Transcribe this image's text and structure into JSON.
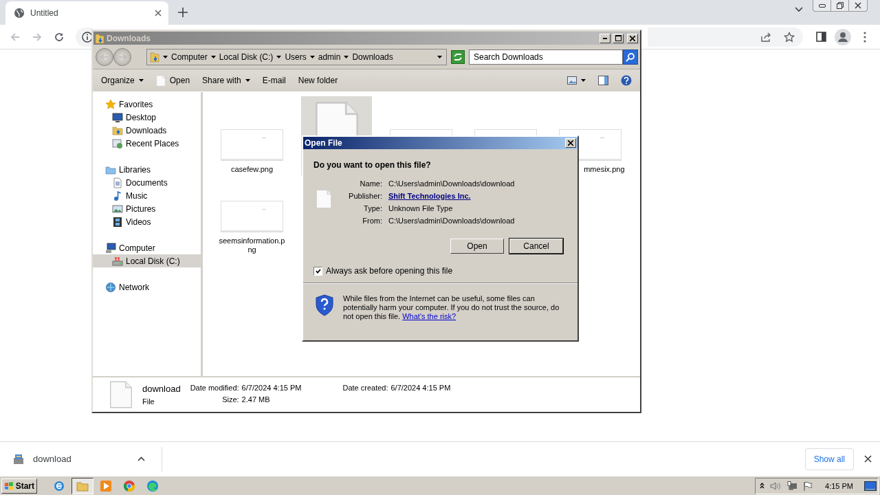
{
  "browser": {
    "tab_title": "Untitled",
    "nav_buttons": [
      {
        "kind": "back",
        "disabled": true
      },
      {
        "kind": "forward",
        "disabled": true
      },
      {
        "kind": "reload",
        "disabled": false
      }
    ]
  },
  "explorer": {
    "title": "Downloads",
    "breadcrumb": [
      "Computer",
      "Local Disk (C:)",
      "Users",
      "admin",
      "Downloads"
    ],
    "search": {
      "placeholder": "Search Downloads"
    },
    "commands": [
      {
        "label": "Organize",
        "kind": "menu"
      },
      {
        "label": "Open",
        "kind": "file"
      },
      {
        "label": "Share with",
        "kind": "menu"
      },
      {
        "label": "E-mail",
        "kind": "plain"
      },
      {
        "label": "New folder",
        "kind": "plain"
      }
    ],
    "nav_tree": [
      {
        "label": "Favorites",
        "kind": "star",
        "selected": false,
        "children": [
          {
            "label": "Desktop",
            "kind": "desktop",
            "selected": false
          },
          {
            "label": "Downloads",
            "kind": "download-folder",
            "selected": false
          },
          {
            "label": "Recent Places",
            "kind": "recent",
            "selected": false
          }
        ]
      },
      {
        "label": "Libraries",
        "kind": "library",
        "selected": false,
        "children": [
          {
            "label": "Documents",
            "kind": "document",
            "selected": false
          },
          {
            "label": "Music",
            "kind": "music",
            "selected": false
          },
          {
            "label": "Pictures",
            "kind": "pictures",
            "selected": false
          },
          {
            "label": "Videos",
            "kind": "video",
            "selected": false
          }
        ]
      },
      {
        "label": "Computer",
        "kind": "computer",
        "selected": false,
        "children": [
          {
            "label": "Local Disk (C:)",
            "kind": "disk",
            "selected": true
          }
        ]
      },
      {
        "label": "Network",
        "kind": "network",
        "selected": false
      }
    ],
    "files": [
      {
        "name": "casefew.png",
        "kind": "thumbnail",
        "selected": false
      },
      {
        "kind": "blank-file",
        "selected": true
      },
      {
        "kind": "thumbnail",
        "selected": false
      },
      {
        "kind": "thumbnail",
        "selected": false
      },
      {
        "name": "mmesix.png",
        "kind": "thumbnail",
        "selected": false
      },
      {
        "name": "seemsinformation.png",
        "kind": "thumbnail",
        "selected": false
      }
    ],
    "details": {
      "name": "download",
      "type": "File",
      "columns": [
        [
          {
            "label": "Date modified:",
            "value": "6/7/2024 4:15 PM"
          },
          {
            "label": "Size:",
            "value": "2.47 MB"
          }
        ],
        [
          {
            "label": "Date created:",
            "value": "6/7/2024 4:15 PM"
          }
        ]
      ]
    }
  },
  "dialog": {
    "title": "Open File",
    "question": "Do you want to open this file?",
    "fields": [
      {
        "label": "Name:",
        "value": "C:\\Users\\admin\\Downloads\\download",
        "kind": "text"
      },
      {
        "label": "Publisher:",
        "value": "Shift Technologies Inc.",
        "kind": "link"
      },
      {
        "label": "Type:",
        "value": "Unknown File Type",
        "kind": "text"
      },
      {
        "label": "From:",
        "value": "C:\\Users\\admin\\Downloads\\download",
        "kind": "text"
      }
    ],
    "buttons": [
      {
        "label": "Open",
        "default": false
      },
      {
        "label": "Cancel",
        "default": true
      }
    ],
    "checkbox": {
      "label": "Always ask before opening this file",
      "checked": true
    },
    "warning": {
      "text": "While files from the Internet can be useful, some files can potentially harm your computer. If you do not trust the source, do not open this file.",
      "link": "What's the risk?"
    }
  },
  "downloads_bar": {
    "items": [
      {
        "name": "download"
      }
    ],
    "show_all": "Show all"
  },
  "taskbar": {
    "start": "Start",
    "apps": [
      {
        "kind": "ie",
        "active": false
      },
      {
        "kind": "folder",
        "active": true
      },
      {
        "kind": "media",
        "active": false
      },
      {
        "kind": "chrome",
        "active": false
      },
      {
        "kind": "edge",
        "active": false
      }
    ],
    "clock": "4:15 PM"
  }
}
